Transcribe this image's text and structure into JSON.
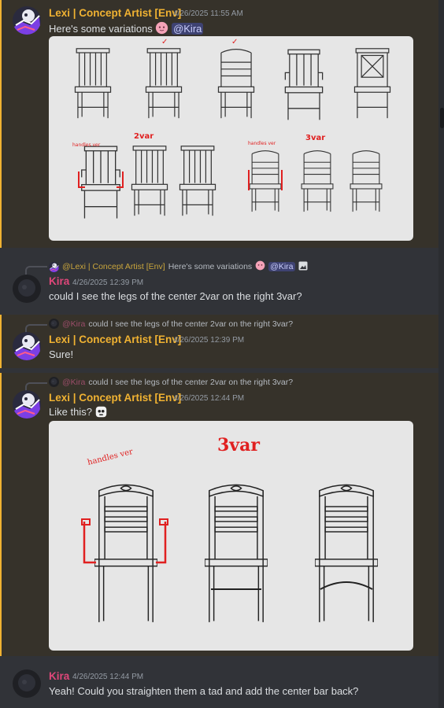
{
  "messages": [
    {
      "author": "Lexi | Concept Artist [Env]",
      "timestamp": "4/26/2025 11:55 AM",
      "text": "Here's some variations",
      "mention": "@Kira",
      "attachment_annotations": {
        "left_note": "handles ver",
        "mid_note": "2var",
        "right_note": "handles ver",
        "right_title": "3var",
        "checks": [
          "✓",
          "✓"
        ]
      }
    },
    {
      "reply": {
        "author": "@Lexi | Concept Artist [Env]",
        "text": "Here's some variations",
        "mention": "@Kira"
      },
      "author": "Kira",
      "timestamp": "4/26/2025 12:39 PM",
      "text": "could I see the legs of the center 2var on the right 3var?"
    },
    {
      "reply": {
        "author": "@Kira",
        "text": "could I see the legs of the center 2var on the right 3var?"
      },
      "author": "Lexi | Concept Artist [Env]",
      "timestamp": "4/26/2025 12:39 PM",
      "text": "Sure!"
    },
    {
      "reply": {
        "author": "@Kira",
        "text": "could I see the legs of the center 2var on the right 3var?"
      },
      "author": "Lexi | Concept Artist [Env]",
      "timestamp": "4/26/2025 12:44 PM",
      "text": "Like this?",
      "attachment_annotations": {
        "title": "3var",
        "note": "handles ver"
      }
    },
    {
      "author": "Kira",
      "timestamp": "4/26/2025 12:44 PM",
      "text": "Yeah! Could you straighten them a tad and add the center bar back?"
    }
  ],
  "icons": [
    "lexi-avatar",
    "kira-avatar",
    "blush-emoji",
    "skull-emoji",
    "image-icon"
  ],
  "colors": {
    "background": "#313338",
    "highlight": "#36322a",
    "highlight_bar": "#f0b232",
    "lexi": "#f0b232",
    "kira": "#e0477a",
    "mention_bg": "#3e4272"
  }
}
